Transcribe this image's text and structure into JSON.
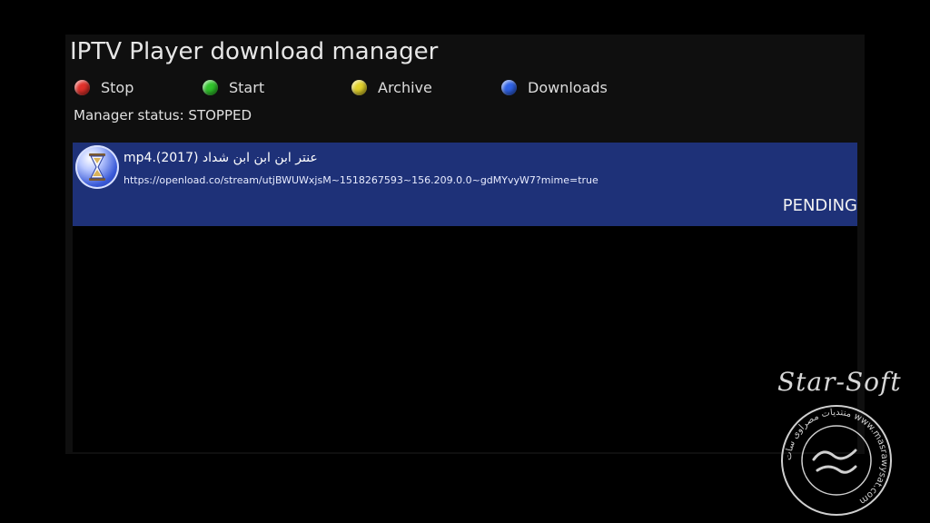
{
  "window": {
    "title": "IPTV Player download manager"
  },
  "legend": {
    "items": [
      {
        "label": "Stop",
        "color": "#e0302a",
        "icon": "red-circle-icon"
      },
      {
        "label": "Start",
        "color": "#2fc42a",
        "icon": "green-circle-icon"
      },
      {
        "label": "Archive",
        "color": "#e2d22a",
        "icon": "yellow-circle-icon"
      },
      {
        "label": "Downloads",
        "color": "#2f62e6",
        "icon": "blue-circle-icon"
      }
    ]
  },
  "manager": {
    "status_text": "Manager status: STOPPED"
  },
  "downloads": [
    {
      "title": "عنتر ابن ابن ابن شداد (2017).mp4",
      "url": "https://openload.co/stream/utjBWUWxjsM~1518267593~156.209.0.0~gdMYvyW7?mime=true",
      "status": "PENDING",
      "icon": "hourglass-icon"
    }
  ],
  "colors": {
    "selected_row": "#1e3178",
    "background": "#000000",
    "panel": "#0f0f0f"
  },
  "watermark": {
    "brand": "Star-Soft",
    "seal_text": "منتديات مصراوى سات  www.masrawysat.com"
  }
}
